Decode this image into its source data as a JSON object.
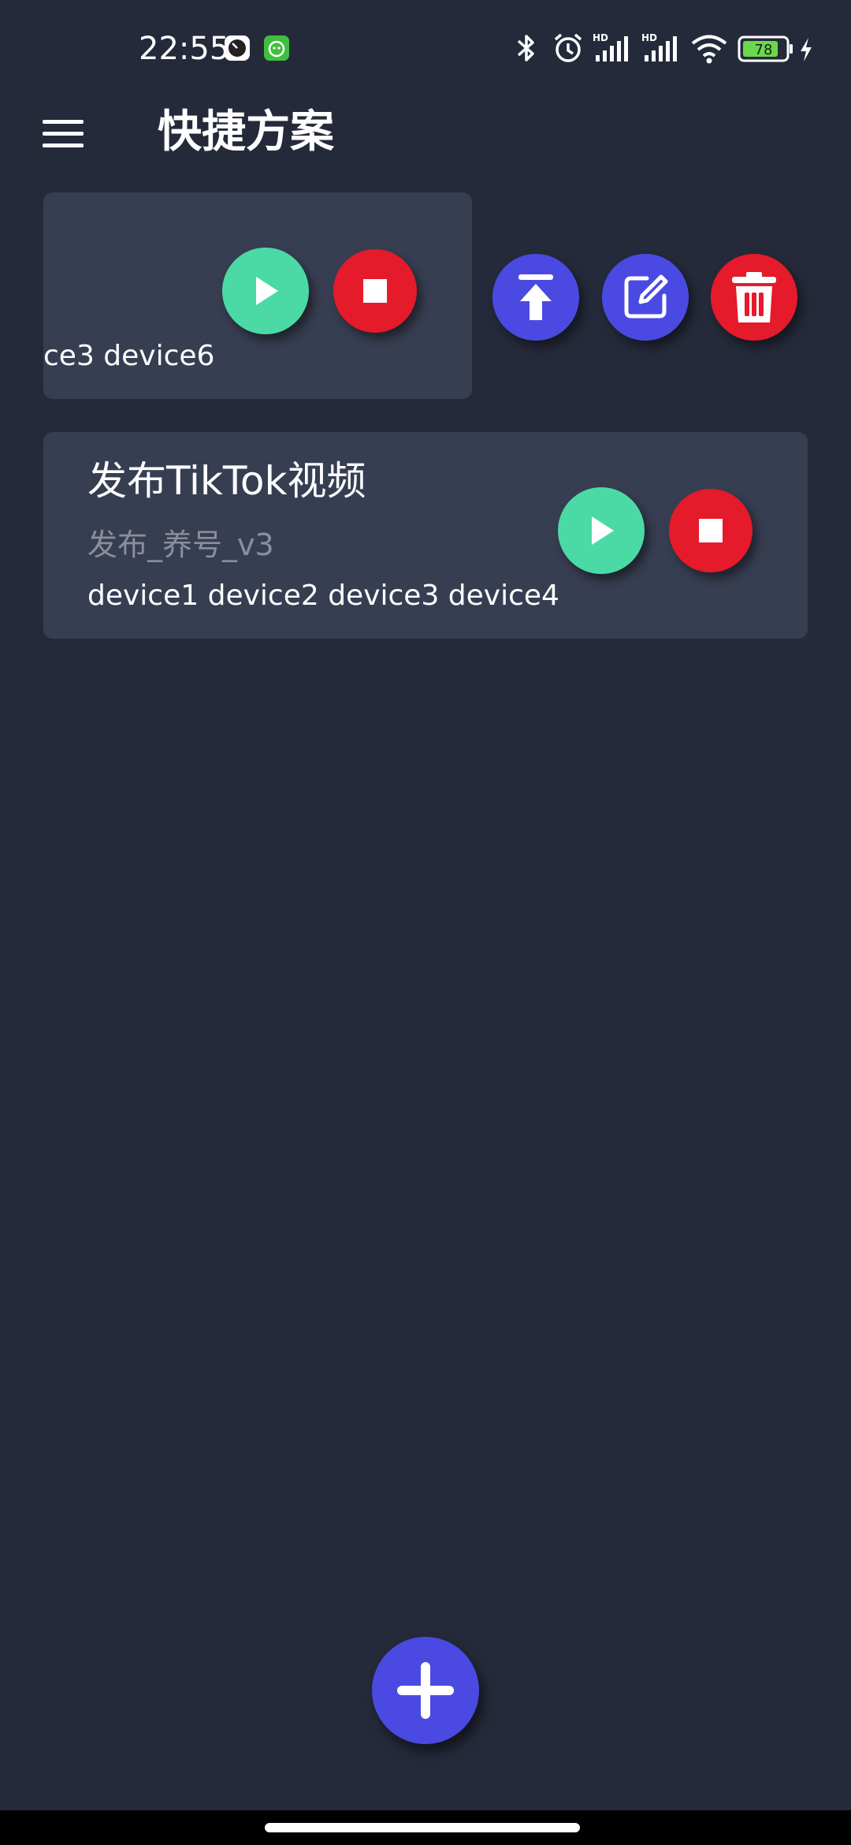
{
  "status_bar": {
    "time": "22:55",
    "battery_level": "78",
    "icons": [
      "clock-app-icon",
      "green-app-icon",
      "bluetooth-icon",
      "alarm-icon",
      "hd-signal-icon",
      "hd-signal-icon",
      "wifi-icon",
      "battery-icon",
      "charging-icon"
    ]
  },
  "header": {
    "menu_icon": "hamburger-menu-icon",
    "title": "快捷方案"
  },
  "plans": [
    {
      "title": "",
      "subtitle": "",
      "devices": "ce3 device6",
      "swiped_open": true,
      "actions": [
        "move-to-top-icon",
        "edit-icon",
        "delete-icon"
      ]
    },
    {
      "title": "发布TikTok视频",
      "subtitle": "发布_养号_v3",
      "devices": "device1 device2 device3 device4",
      "swiped_open": false
    }
  ],
  "fab": {
    "icon": "plus-icon"
  },
  "colors": {
    "background": "#252a3a",
    "card": "#383e52",
    "play": "#4bdaa6",
    "stop": "#e51a2b",
    "accent": "#4a4ae3",
    "subtitle": "#8a8f9e"
  }
}
